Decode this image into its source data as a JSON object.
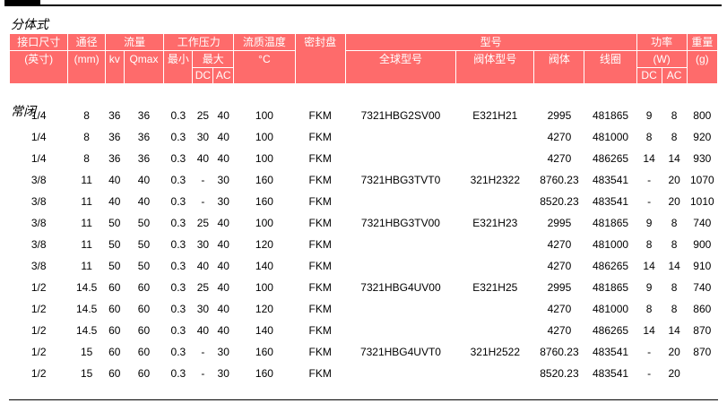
{
  "section_title": "分体式",
  "subsection_title": "常闭",
  "header": {
    "row1": [
      "接口尺寸",
      "通径",
      "流量",
      "工作压力",
      "流质温度",
      "密封盘",
      "型号",
      "功率",
      "重量"
    ],
    "row2": [
      "(英寸)",
      "(mm)",
      "kv",
      "Qmax",
      "最小",
      "最大",
      "°C",
      "全球型号",
      "阀体型号",
      "阀体",
      "线圈",
      "(W)",
      "(g)"
    ],
    "row3": [
      "DC",
      "AC",
      "DC",
      "AC"
    ]
  },
  "rows": [
    [
      "1/4",
      "8",
      "36",
      "36",
      "0.3",
      "25",
      "40",
      "100",
      "FKM",
      "7321HBG2SV00",
      "E321H21",
      "2995",
      "481865",
      "9",
      "8",
      "800"
    ],
    [
      "1/4",
      "8",
      "36",
      "36",
      "0.3",
      "30",
      "40",
      "100",
      "FKM",
      "",
      "",
      "4270",
      "481000",
      "8",
      "8",
      "920"
    ],
    [
      "1/4",
      "8",
      "36",
      "36",
      "0.3",
      "40",
      "40",
      "100",
      "FKM",
      "",
      "",
      "4270",
      "486265",
      "14",
      "14",
      "930"
    ],
    [
      "3/8",
      "11",
      "40",
      "40",
      "0.3",
      "-",
      "30",
      "160",
      "FKM",
      "7321HBG3TVT0",
      "321H2322",
      "8760.23",
      "483541",
      "-",
      "20",
      "1070"
    ],
    [
      "3/8",
      "11",
      "40",
      "40",
      "0.3",
      "-",
      "30",
      "160",
      "FKM",
      "",
      "",
      "8520.23",
      "483541",
      "-",
      "20",
      "1010"
    ],
    [
      "3/8",
      "11",
      "50",
      "50",
      "0.3",
      "25",
      "40",
      "100",
      "FKM",
      "7321HBG3TV00",
      "E321H23",
      "2995",
      "481865",
      "9",
      "8",
      "740"
    ],
    [
      "3/8",
      "11",
      "50",
      "50",
      "0.3",
      "30",
      "40",
      "120",
      "FKM",
      "",
      "",
      "4270",
      "481000",
      "8",
      "8",
      "900"
    ],
    [
      "3/8",
      "11",
      "50",
      "50",
      "0.3",
      "40",
      "40",
      "140",
      "FKM",
      "",
      "",
      "4270",
      "486265",
      "14",
      "14",
      "910"
    ],
    [
      "1/2",
      "14.5",
      "60",
      "60",
      "0.3",
      "25",
      "40",
      "100",
      "FKM",
      "7321HBG4UV00",
      "E321H25",
      "2995",
      "481865",
      "9",
      "8",
      "740"
    ],
    [
      "1/2",
      "14.5",
      "60",
      "60",
      "0.3",
      "30",
      "40",
      "120",
      "FKM",
      "",
      "",
      "4270",
      "481000",
      "8",
      "8",
      "860"
    ],
    [
      "1/2",
      "14.5",
      "60",
      "60",
      "0.3",
      "40",
      "40",
      "140",
      "FKM",
      "",
      "",
      "4270",
      "486265",
      "14",
      "14",
      "870"
    ],
    [
      "1/2",
      "15",
      "60",
      "60",
      "0.3",
      "-",
      "30",
      "160",
      "FKM",
      "7321HBG4UVT0",
      "321H2522",
      "8760.23",
      "483541",
      "-",
      "20",
      "870"
    ],
    [
      "1/2",
      "15",
      "60",
      "60",
      "0.3",
      "-",
      "30",
      "160",
      "FKM",
      "",
      "",
      "8520.23",
      "483541",
      "-",
      "20",
      ""
    ]
  ],
  "colors": {
    "header_bg": "#fe6b6b",
    "header_text": "#ffffff"
  }
}
